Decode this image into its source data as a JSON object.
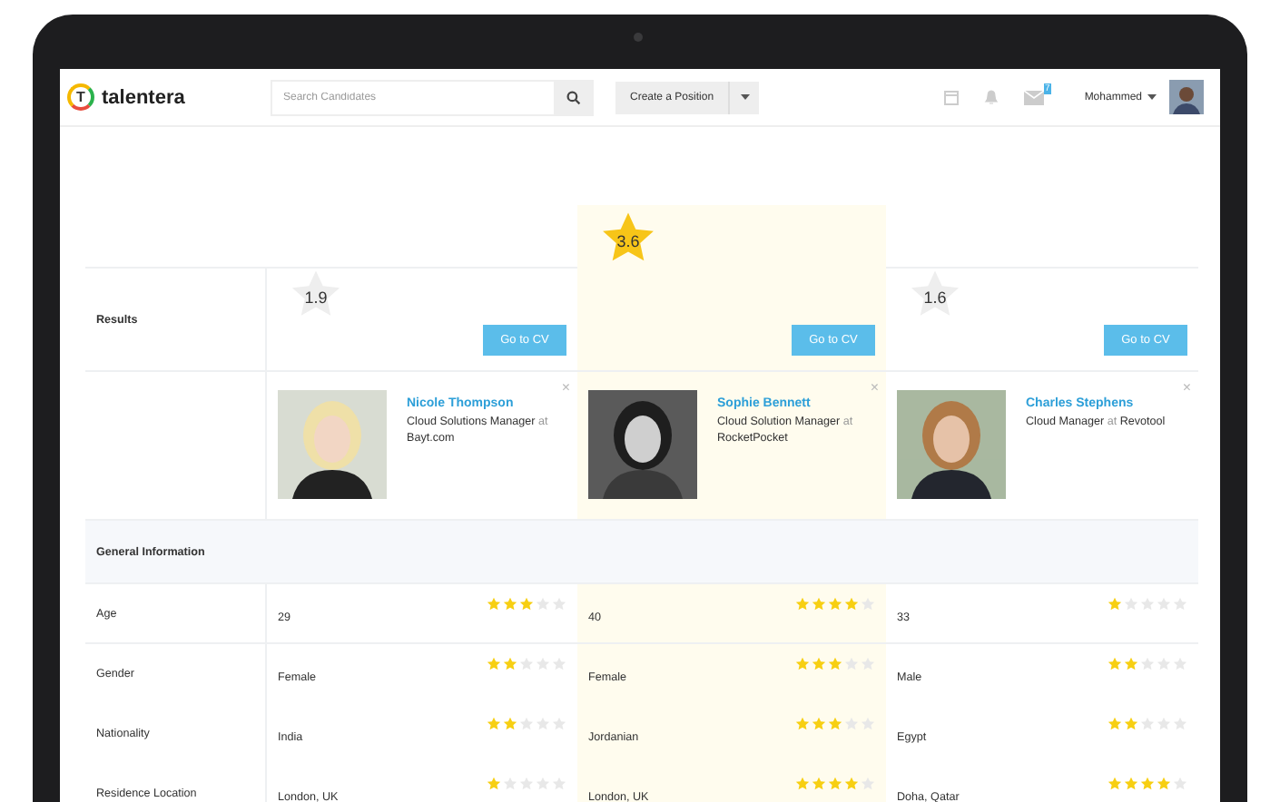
{
  "header": {
    "logo_letter": "T",
    "brand": "talentera",
    "search": {
      "placeholder": "Search Candidates"
    },
    "create_button": "Create a Position",
    "mail_badge": "7",
    "user": "Mohammed"
  },
  "results_label": "Results",
  "candidates": [
    {
      "score": "1.9",
      "selected": false,
      "button": "Go to CV",
      "close": "×",
      "name": "Nicole Thompson",
      "role": "Cloud Solutions Manager",
      "connector": "at",
      "company": "Bayt.com"
    },
    {
      "score": "3.6",
      "selected": true,
      "button": "Go to CV",
      "close": "×",
      "name": "Sophie Bennett",
      "role": "Cloud Solution Manager",
      "connector": "at",
      "company": "RocketPocket"
    },
    {
      "score": "1.6",
      "selected": false,
      "button": "Go to CV",
      "close": "×",
      "name": "Charles Stephens",
      "role": "Cloud Manager",
      "connector": "at",
      "company": "Revotool"
    }
  ],
  "section": "General Information",
  "rows": [
    {
      "label": "Age",
      "values": [
        {
          "text": "29",
          "stars": 3
        },
        {
          "text": "40",
          "stars": 4
        },
        {
          "text": "33",
          "stars": 1
        }
      ]
    },
    {
      "label": "Gender",
      "values": [
        {
          "text": "Female",
          "stars": 2
        },
        {
          "text": "Female",
          "stars": 3
        },
        {
          "text": "Male",
          "stars": 2
        }
      ]
    },
    {
      "label": "Nationality",
      "values": [
        {
          "text": "India",
          "stars": 2
        },
        {
          "text": "Jordanian",
          "stars": 3
        },
        {
          "text": "Egypt",
          "stars": 2
        }
      ]
    },
    {
      "label": "Residence Location",
      "values": [
        {
          "text": "London, UK",
          "stars": 1
        },
        {
          "text": "London, UK",
          "stars": 4
        },
        {
          "text": "Doha, Qatar",
          "stars": 4
        }
      ]
    }
  ]
}
